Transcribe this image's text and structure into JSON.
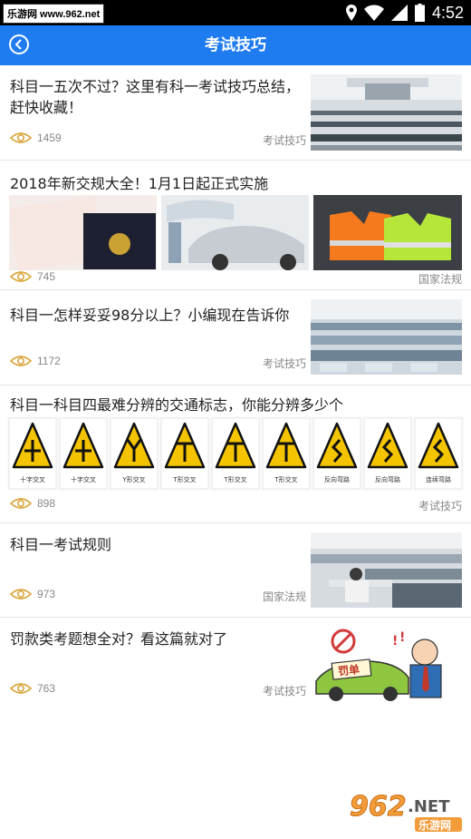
{
  "status_bar": {
    "watermark": "乐游网 www.962.net",
    "time": "4:52"
  },
  "app_bar": {
    "title": "考试技巧"
  },
  "articles": [
    {
      "title": "科目一五次不过？这里有科一考试技巧总结，赶快收藏！",
      "views": "1459",
      "tag": "考试技巧"
    },
    {
      "title": "2018年新交规大全！1月1日起正式实施",
      "views": "745",
      "tag": "国家法规"
    },
    {
      "title": "科目一怎样妥妥98分以上？小编现在告诉你",
      "views": "1172",
      "tag": "考试技巧"
    },
    {
      "title": "科目一科目四最难分辨的交通标志，你能分辨多少个",
      "views": "898",
      "tag": "考试技巧",
      "signs": [
        "十字交叉",
        "十字交叉",
        "Y形交叉",
        "T形交叉",
        "T形交叉",
        "T形交叉",
        "反向弯路",
        "反向弯路",
        "连续弯路"
      ]
    },
    {
      "title": "科目一考试规则",
      "views": "973",
      "tag": "国家法规"
    },
    {
      "title": "罚款类考题想全对？看这篇就对了",
      "views": "763",
      "tag": "考试技巧",
      "thumb_text": "罚单"
    }
  ],
  "watermark": {
    "num": "962",
    "net": ".NET",
    "sub": "乐游网"
  },
  "colors": {
    "app_bar": "#1f7cf0",
    "meta_text": "#888888"
  }
}
